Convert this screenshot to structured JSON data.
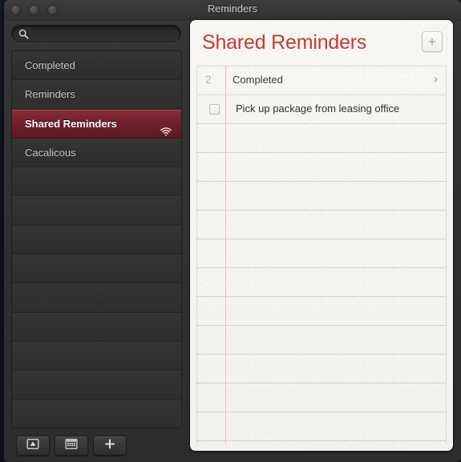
{
  "window": {
    "title": "Reminders",
    "controls": [
      {
        "name": "close",
        "label": ""
      },
      {
        "name": "minimize",
        "label": ""
      },
      {
        "name": "zoom",
        "label": ""
      }
    ]
  },
  "search": {
    "value": "",
    "placeholder": "",
    "icon": "search-icon"
  },
  "sidebar": {
    "items": [
      {
        "label": "Completed",
        "selected": false,
        "shared": false
      },
      {
        "label": "Reminders",
        "selected": false,
        "shared": false
      },
      {
        "label": "Shared Reminders",
        "selected": true,
        "shared": true
      },
      {
        "label": "Cacalicous",
        "selected": false,
        "shared": false
      }
    ],
    "empty_row_count": 9
  },
  "toolbar": {
    "buttons": [
      {
        "name": "show-panel-button",
        "icon": "panel-icon",
        "label": ""
      },
      {
        "name": "calendar-button",
        "icon": "calendar-icon",
        "label": ""
      },
      {
        "name": "add-list-button",
        "icon": "plus-icon",
        "label": "+"
      }
    ]
  },
  "detail": {
    "title": "Shared Reminders",
    "add_button_label": "+",
    "completed": {
      "count": "2",
      "label": "Completed",
      "chevron": "›"
    },
    "reminders": [
      {
        "text": "Pick up package from leasing office",
        "checked": false
      }
    ],
    "blank_row_count": 10
  },
  "colors": {
    "accent_red": "#c33c32",
    "selection_red": "#6d2029",
    "margin_pink": "#f3b8c4",
    "window_chrome": "#323232",
    "paper": "#f5f4f0"
  }
}
